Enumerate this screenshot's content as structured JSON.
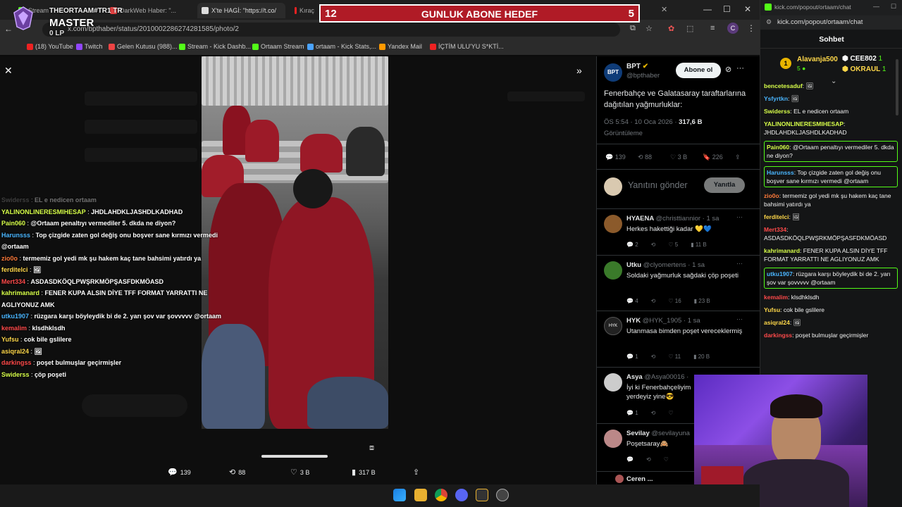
{
  "browser": {
    "tabs": [
      {
        "label": "Stream",
        "color": "#53fc18"
      },
      {
        "label": "DarkWeb Haber: \"...",
        "color": "#e44"
      },
      {
        "label": "X'te HAGİ: \"https://t.co/",
        "color": "#ddd"
      },
      {
        "label": "Kıraç",
        "color": "#e22"
      }
    ],
    "url": "x.com/bpthaber/status/2010002286274281585/photo/2",
    "bookmarks": [
      {
        "label": "(18) YouTube",
        "color": "#e22"
      },
      {
        "label": "Twitch",
        "color": "#9146ff"
      },
      {
        "label": "Gelen Kutusu (988)...",
        "color": "#e44"
      },
      {
        "label": "Stream - Kick Dashb...",
        "color": "#53fc18"
      },
      {
        "label": "Ortaam Stream",
        "color": "#53fc18"
      },
      {
        "label": "ortaam - Kick Stats,...",
        "color": "#4aa3ff"
      },
      {
        "label": "Yandex Mail",
        "color": "#f90"
      },
      {
        "label": "İÇTİM ULU'YU S*KTİ...",
        "color": "#e22"
      }
    ]
  },
  "streamer_badge": {
    "line1": "THEORTAAM#TR1 TR",
    "line2": "MASTER",
    "line3": "0 LP"
  },
  "goal_banner": {
    "left_number": "12",
    "label": "GUNLUK ABONE HEDEF",
    "right_number": "5"
  },
  "photo_stats": {
    "replies": "139",
    "reposts": "88",
    "likes": "3 B",
    "views": "317 B"
  },
  "tweet": {
    "name": "BPT",
    "handle": "@bpthaber",
    "subscribe_label": "Abone ol",
    "text": "Fenerbahçe ve Galatasaray taraftarlarına dağıtılan yağmurluklar:",
    "time": "ÖS 5:54 · 10 Oca 2026 ·",
    "views_count": "317,6 B",
    "views_label": "Görüntüleme",
    "replies": "139",
    "reposts": "88",
    "likes": "3 B",
    "bookmarks": "226",
    "reply_placeholder": "Yanıtını gönder",
    "reply_button": "Yanıtla"
  },
  "replies": [
    {
      "name": "HYAENA",
      "handle": "@christtiannior · 1 sa",
      "text": "Herkes hakettiği kadar 💛💙",
      "r": "2",
      "rt": "",
      "l": "5",
      "v": "11 B",
      "av": "#8b5a2b"
    },
    {
      "name": "Utku",
      "handle": "@clyomertens · 1 sa",
      "text": "Soldaki yağmurluk sağdaki çöp poşeti",
      "r": "4",
      "rt": "",
      "l": "16",
      "v": "23 B",
      "av": "#3a7a2a"
    },
    {
      "name": "HYK",
      "handle": "@HYK_1905 · 1 sa",
      "text": "Utanmasa bimden poşet vereceklermiş",
      "r": "1",
      "rt": "",
      "l": "11",
      "v": "20 B",
      "av": "#222"
    },
    {
      "name": "Asya",
      "handle": "@Asya00016 · ",
      "text": "İyi ki Fenerbahçeliyim yerdeyiz yine😎",
      "r": "1",
      "rt": "",
      "l": "",
      "v": "",
      "av": "#ccc"
    },
    {
      "name": "Sevilay",
      "handle": "@sevilayuna",
      "text": "Poşetsaray🙈",
      "r": "",
      "rt": "",
      "l": "",
      "v": "",
      "av": "#b88"
    },
    {
      "name": "Ceren ...",
      "handle": "",
      "text": "",
      "r": "",
      "rt": "",
      "l": "",
      "v": "",
      "av": "#a55"
    }
  ],
  "overlay_chat": [
    {
      "user": "Swiderss",
      "color": "#888",
      "msg": "EL e nedicen ortaam"
    },
    {
      "user": "YALINONLINERESMIHESAP",
      "color": "#d8ff4a",
      "msg": "JHDLAHDKLJASHDLKADHAD"
    },
    {
      "user": "Pain060",
      "color": "#d8ff4a",
      "msg": "@Ortaam penaltıyı vermediler 5. dkda ne diyon?"
    },
    {
      "user": "Harunsss",
      "color": "#4ab6ff",
      "msg": "Top çizgide zaten gol değiş onu boşver sane kırmızı vermedi"
    },
    {
      "user": "",
      "color": "#fff",
      "msg": "@ortaam"
    },
    {
      "user": "zio0o",
      "color": "#ff7a3a",
      "msg": "termemiz gol yedi mk şu hakem kaç tane bahsimi yatırdı ya"
    },
    {
      "user": "ferditelci",
      "color": "#ffd84a",
      "msg": "🖼"
    },
    {
      "user": "Mert334",
      "color": "#ff4a4a",
      "msg": "ASDASDKÖQLPWŞRKMÖPŞASFDKMÖASD"
    },
    {
      "user": "kahrimanard",
      "color": "#d8ff4a",
      "msg": "FENER KUPA ALSIN DİYE TFF FORMAT YARRATTI NE"
    },
    {
      "user": "",
      "color": "#fff",
      "msg": "AGLIYONUZ AMK"
    },
    {
      "user": "utku1907",
      "color": "#4ab6ff",
      "msg": "rüzgara karşı böyleydik bi de 2. yarı şov var şovvvvv @ortaam"
    },
    {
      "user": "kemalim",
      "color": "#ff4a4a",
      "msg": "klsdhklsdh"
    },
    {
      "user": "Yufsu",
      "color": "#ffd84a",
      "msg": "cok bile gslilere"
    },
    {
      "user": "asiqral24",
      "color": "#ffd84a",
      "msg": "🖼"
    },
    {
      "user": "darkingss",
      "color": "#ff4a4a",
      "msg": "poşet bulmuşlar geçirmişler"
    },
    {
      "user": "Swiderss",
      "color": "#d8ff4a",
      "msg": "çöp poşeti"
    }
  ],
  "kick": {
    "url": "kick.com/popout/ortaam/chat",
    "title": "Sohbet",
    "top_user": "Alavanja500",
    "top_user_count": "5",
    "leader2": "CEE802",
    "leader2_count": "1",
    "leader3": "OKRAUL",
    "leader3_count": "1",
    "messages": [
      {
        "user": "bencetesaduf",
        "color": "#d8ff4a",
        "msg": "🖼",
        "hl": false
      },
      {
        "user": "Ysfyrtkn",
        "color": "#4ab6ff",
        "msg": "🖼",
        "hl": false
      },
      {
        "user": "Swiderss",
        "color": "#d8ff4a",
        "msg": "EL e nedicen ortaam",
        "hl": false
      },
      {
        "user": "YALINONLINERESMIHESAP",
        "color": "#d8ff4a",
        "msg": "JHDLAHDKLJASHDLKADHAD",
        "hl": false
      },
      {
        "user": "Pain060",
        "color": "#d8ff4a",
        "msg": "@Ortaam penaltıyı vermediler 5. dkda ne diyon?",
        "hl": true
      },
      {
        "user": "Harunsss",
        "color": "#4ab6ff",
        "msg": "Top çizgide zaten gol değiş onu boşver sane kırmızı vermedi @ortaam",
        "hl": true
      },
      {
        "user": "zio0o",
        "color": "#ff7a3a",
        "msg": "termemiz gol yedi mk şu hakem kaç tane bahsimi yatırdı ya",
        "hl": false
      },
      {
        "user": "ferditelci",
        "color": "#ffd84a",
        "msg": "🖼",
        "hl": false
      },
      {
        "user": "Mert334",
        "color": "#ff4a4a",
        "msg": "ASDASDKÖQLPWŞRKMÖPŞASFDKMÖASD",
        "hl": false
      },
      {
        "user": "kahrimanard",
        "color": "#d8ff4a",
        "msg": "FENER KUPA ALSIN DİYE TFF FORMAT YARRATTI NE AGLIYONUZ AMK",
        "hl": false
      },
      {
        "user": "utku1907",
        "color": "#4ab6ff",
        "msg": "rüzgara karşı böyleydik bi de 2. yarı şov var şovvvvv @ortaam",
        "hl": true
      },
      {
        "user": "kemalim",
        "color": "#ff4a4a",
        "msg": "klsdhklsdh",
        "hl": false
      },
      {
        "user": "Yufsu",
        "color": "#ffd84a",
        "msg": "cok bile gslilere",
        "hl": false
      },
      {
        "user": "asiqral24",
        "color": "#ffd84a",
        "msg": "🖼",
        "hl": false
      },
      {
        "user": "darkingss",
        "color": "#ff4a4a",
        "msg": "poşet bulmuşlar geçirmişler",
        "hl": false
      }
    ]
  },
  "colors": {
    "accent": "#1d9bf0",
    "kick_green": "#53fc18",
    "banner_red": "#b01b26"
  }
}
